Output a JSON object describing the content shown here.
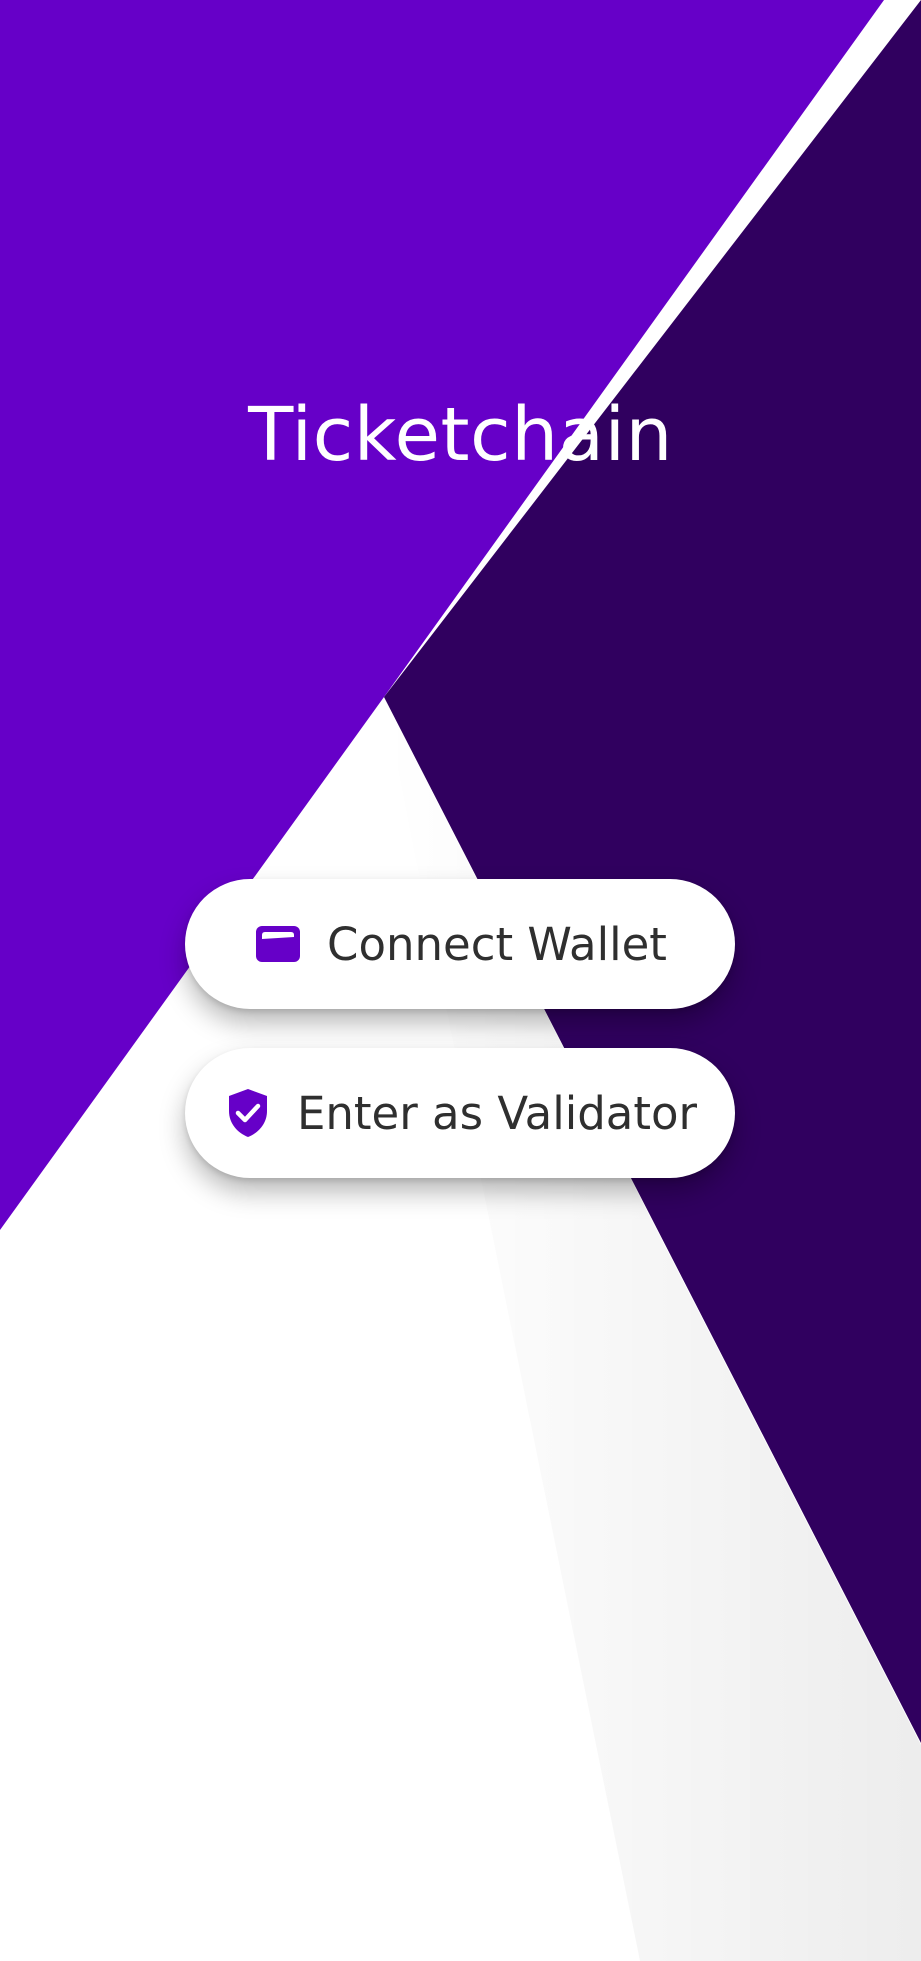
{
  "app": {
    "title": "Ticketchain"
  },
  "actions": {
    "connect_wallet": {
      "label": "Connect Wallet",
      "icon": "wallet-icon"
    },
    "enter_validator": {
      "label": "Enter as Validator",
      "icon": "shield-check-icon"
    }
  },
  "colors": {
    "primary_purple": "#6600c8",
    "dark_purple": "#30005f",
    "background": "#ffffff",
    "button_text": "#2f2f2f"
  }
}
